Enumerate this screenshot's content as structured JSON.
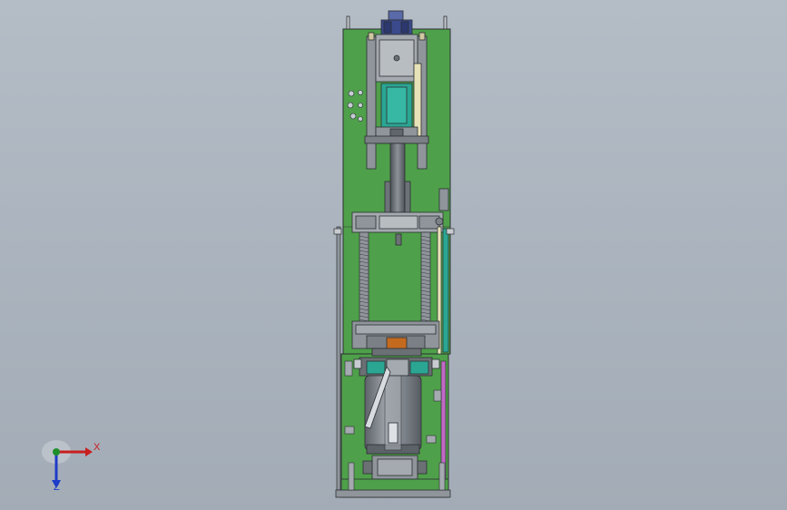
{
  "viewport": {
    "background_top": "#b4bcc6",
    "background_bottom": "#a3acb6"
  },
  "model": {
    "description_colors": {
      "plate": "#4fa04a",
      "plate_dark": "#3d7f39",
      "frame_gray": "#8f959b",
      "motor_gray": "#7b8086",
      "cylinder_teal": "#2aa693",
      "motor_blue": "#3a4a8c",
      "accent_orange": "#c46a1f",
      "accent_magenta": "#c06ac6",
      "outline": "#2b2f33"
    }
  },
  "triad": {
    "x_label": "X",
    "z_label": "Z",
    "x_color": "#c81e1e",
    "y_color": "#1f8f2a",
    "z_color": "#1e3cc8"
  }
}
